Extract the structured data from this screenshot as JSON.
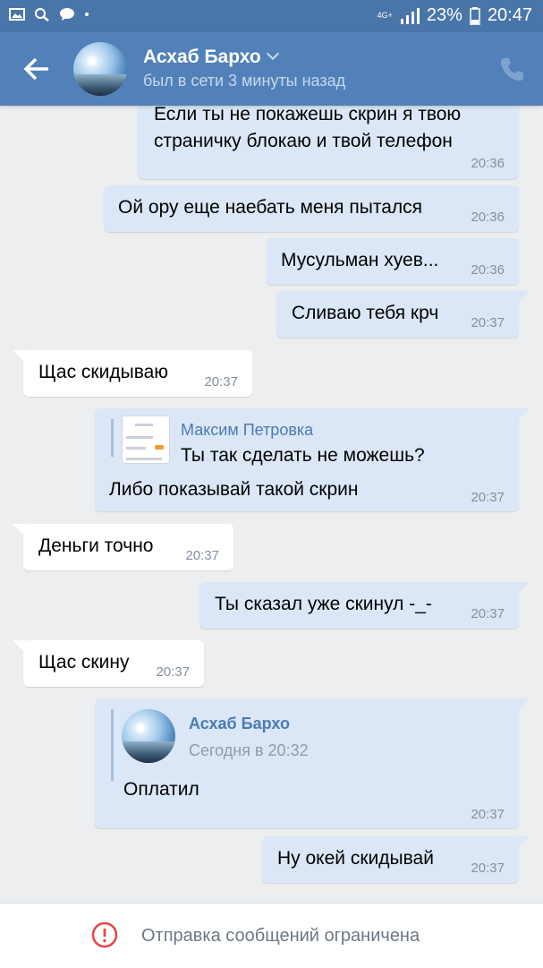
{
  "status_bar": {
    "network": "4G+",
    "battery": "23%",
    "time": "20:47"
  },
  "header": {
    "name": "Асхаб Бархо",
    "status": "был в сети 3 минуты назад"
  },
  "messages": [
    {
      "dir": "out",
      "lines": [
        "Если ты не покажешь скрин я твою",
        "страничку блокаю и твой телефон"
      ],
      "time": "20:36"
    },
    {
      "dir": "out",
      "text": "Ой ору еще наебать меня пытался",
      "time": "20:36"
    },
    {
      "dir": "out",
      "text": "Мусульман хуев...",
      "time": "20:36"
    },
    {
      "dir": "out",
      "text": "Сливаю тебя крч",
      "time": "20:37"
    },
    {
      "dir": "in",
      "text": "Щас скидываю",
      "time": "20:37"
    },
    {
      "dir": "out",
      "reply": {
        "author": "Максим Петровка",
        "text": "Ты так сделать не можешь?"
      },
      "text": "Либо показывай такой скрин",
      "time": "20:37"
    },
    {
      "dir": "in",
      "text": "Деньги точно",
      "time": "20:37"
    },
    {
      "dir": "out",
      "text": "Ты сказал уже скинул -_-",
      "time": "20:37"
    },
    {
      "dir": "in",
      "text": "Щас скину",
      "time": "20:37"
    },
    {
      "dir": "out",
      "forward": {
        "author": "Асхаб Бархо",
        "date": "Сегодня в 20:32",
        "text": "Оплатил"
      },
      "time": "20:37"
    },
    {
      "dir": "out",
      "text": "Ну окей скидывай",
      "time": "20:37"
    }
  ],
  "composer": {
    "restricted_text": "Отправка сообщений ограничена"
  }
}
